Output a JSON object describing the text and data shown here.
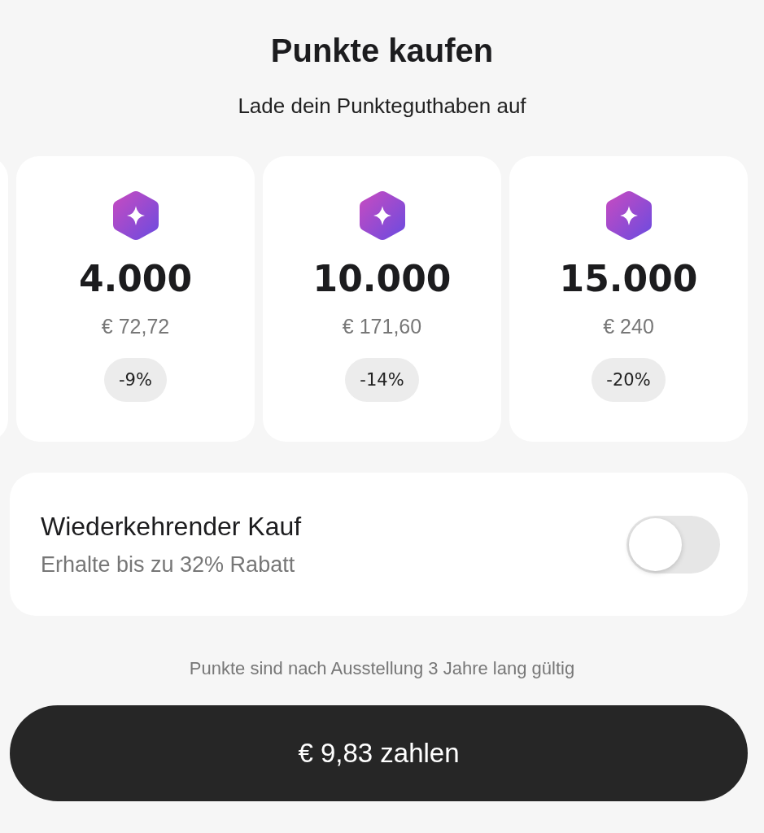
{
  "title": "Punkte kaufen",
  "subtitle": "Lade dein Punkteguthaben auf",
  "packages": [
    {
      "points": "4.000",
      "price": "€ 72,72",
      "discount": "-9%"
    },
    {
      "points": "10.000",
      "price": "€ 171,60",
      "discount": "-14%"
    },
    {
      "points": "15.000",
      "price": "€ 240",
      "discount": "-20%"
    }
  ],
  "recurring": {
    "title": "Wiederkehrender Kauf",
    "subtitle": "Erhalte bis zu 32% Rabatt",
    "on": false
  },
  "note": "Punkte sind nach Ausstellung 3 Jahre lang gültig",
  "pay_button": "€ 9,83 zahlen"
}
